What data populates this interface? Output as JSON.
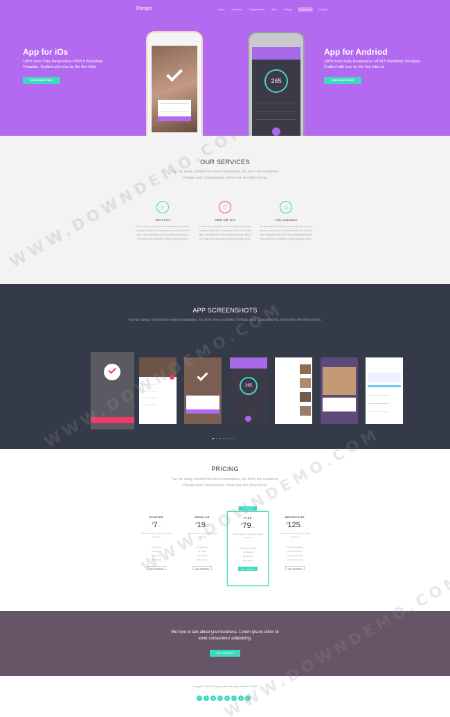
{
  "header": {
    "brand": "Ranger",
    "nav": [
      "Home",
      "Services",
      "Screenshots",
      "Tips",
      "Pricing",
      "Download",
      "Contact"
    ],
    "active_nav": 5
  },
  "hero": {
    "left": {
      "title": "App for iOs",
      "desc": "100% Free Fully Responsive HTML5 Bootstrap Template. Crafted with love by the fine folks",
      "button": "VIEW CASE STUDY"
    },
    "right": {
      "title": "App for Andriod",
      "desc": "100% Free Fully Responsive HTML5 Bootstrap Template. Crafted with love by the fine folks at",
      "button": "VIEW CASE STUDY"
    },
    "galaxy_counter": "265"
  },
  "services": {
    "title": "OUR SERVICES",
    "subtitle": "Far far away, behind the word mountains, far from the countries Vokalia and Consonantia, there live the blind texts.",
    "items": [
      {
        "icon": "wifi-icon",
        "title": "100% Free",
        "desc": "Far far away, behind the word mountains, far from the countries Vokalia and Consonantia, there live the blind texts. Separated they live in Bookmarksgrove right at the coast of the Semantics, a large language ocean."
      },
      {
        "icon": "heart-icon",
        "title": "Made with love",
        "desc": "Far far away, behind the word mountains, far from the countries Vokalia and Consonantia, there live the blind texts. Separated they live in Bookmarksgrove right at the coast of the Semantics, a large language ocean."
      },
      {
        "icon": "monitor-icon",
        "title": "Fully responsive",
        "desc": "Far far away, behind the word mountains, far from the countries Vokalia and Consonantia, there live the blind texts. Separated they live in Bookmarksgrove right at the coast of the Semantics, a large language ocean."
      }
    ],
    "colors": [
      "#3fd9c1",
      "#e2576f",
      "#3fc6d9"
    ]
  },
  "screenshots": {
    "title": "APP SCREENSHOTS",
    "subtitle": "Far far away, behind the word mountains, far from the countries Vokalia and Consonantia, there live the blind texts.",
    "counter": "265"
  },
  "pricing": {
    "title": "PRICING",
    "subtitle": "Far far away, behind the word mountains, far from the countries Vokalia and Consonantia, there live the blind texts.",
    "plans": [
      {
        "name": "STARTER",
        "price": "7",
        "per": "/mo",
        "desc": "Basic customer support for small business",
        "features": [
          "10 projects",
          "20 Pages",
          "20 Emails",
          "100 Images"
        ],
        "button": "GET STARTED"
      },
      {
        "name": "REGULAR",
        "price": "19",
        "per": "/mo",
        "desc": "Basic customer support for small business",
        "features": [
          "20 projects",
          "30 Pages",
          "40 Emails",
          "100 Images"
        ],
        "button": "GET STARTED"
      },
      {
        "name": "PLUS",
        "price": "79",
        "per": "/mo",
        "desc": "Basic customer support for small business",
        "features": [
          "Unlimited projects",
          "400 Pages",
          "300 Emails",
          "700 Images"
        ],
        "button": "GET STARTED",
        "badge": "POPULAR"
      },
      {
        "name": "ENTERPRISE",
        "price": "125",
        "per": "/mo",
        "desc": "Basic customer support for small business",
        "features": [
          "Unlimited projects",
          "Unlimited Pages",
          "Unlimited Emails",
          "Unlimited Images"
        ],
        "button": "GET STARTED"
      }
    ]
  },
  "cta": {
    "text": "We love to talk about your business. Lorem ipsum dolor sit amet consectetur adipisicing.",
    "button": "GET STARTED"
  },
  "footer": {
    "copyright": "Copyright © 2016 Company name All rights reserved.",
    "social": [
      "twitter-icon",
      "facebook-icon",
      "google-icon",
      "linkedin-icon",
      "dribbble-icon",
      "instagram-icon",
      "pinterest-icon",
      "rss-icon"
    ]
  },
  "watermark": "WWW.DOWNDEMO.COM"
}
